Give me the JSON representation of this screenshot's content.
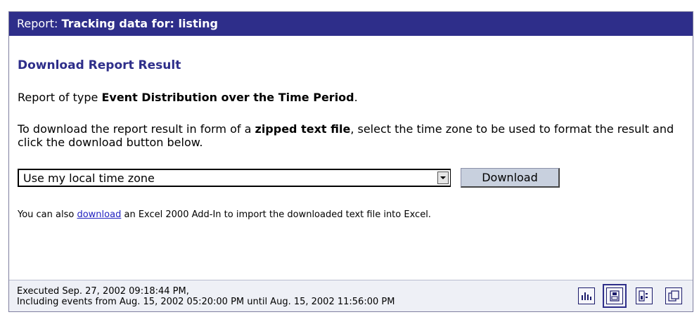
{
  "title": {
    "prefix": "Report: ",
    "bold": "Tracking data for: listing"
  },
  "heading": "Download Report Result",
  "report_type": {
    "prefix": "Report of type ",
    "bold": "Event Distribution over the Time Period",
    "suffix": "."
  },
  "instructions": {
    "prefix": "To download the report result in form of a ",
    "bold": "zipped text file",
    "suffix": ", select the time zone to be used to format the result and click the download button below."
  },
  "timezone_select": {
    "selected": "Use my local time zone"
  },
  "download_button": "Download",
  "excel_note": {
    "prefix": "You can also ",
    "link": "download",
    "suffix": " an Excel 2000 Add-In to import the downloaded text file into Excel."
  },
  "footer": {
    "executed": "Executed Sep. 27, 2002 09:18:44 PM,",
    "range": "Including events from Aug. 15, 2002 05:20:00 PM until Aug. 15, 2002 11:56:00 PM"
  },
  "toolbar_icons": [
    "chart-icon",
    "download-icon",
    "details-icon",
    "copy-icon"
  ],
  "colors": {
    "title_bg": "#2e2e8a",
    "heading": "#2e2e8a",
    "link": "#2020c0",
    "footer_bg": "#eef0f6"
  }
}
